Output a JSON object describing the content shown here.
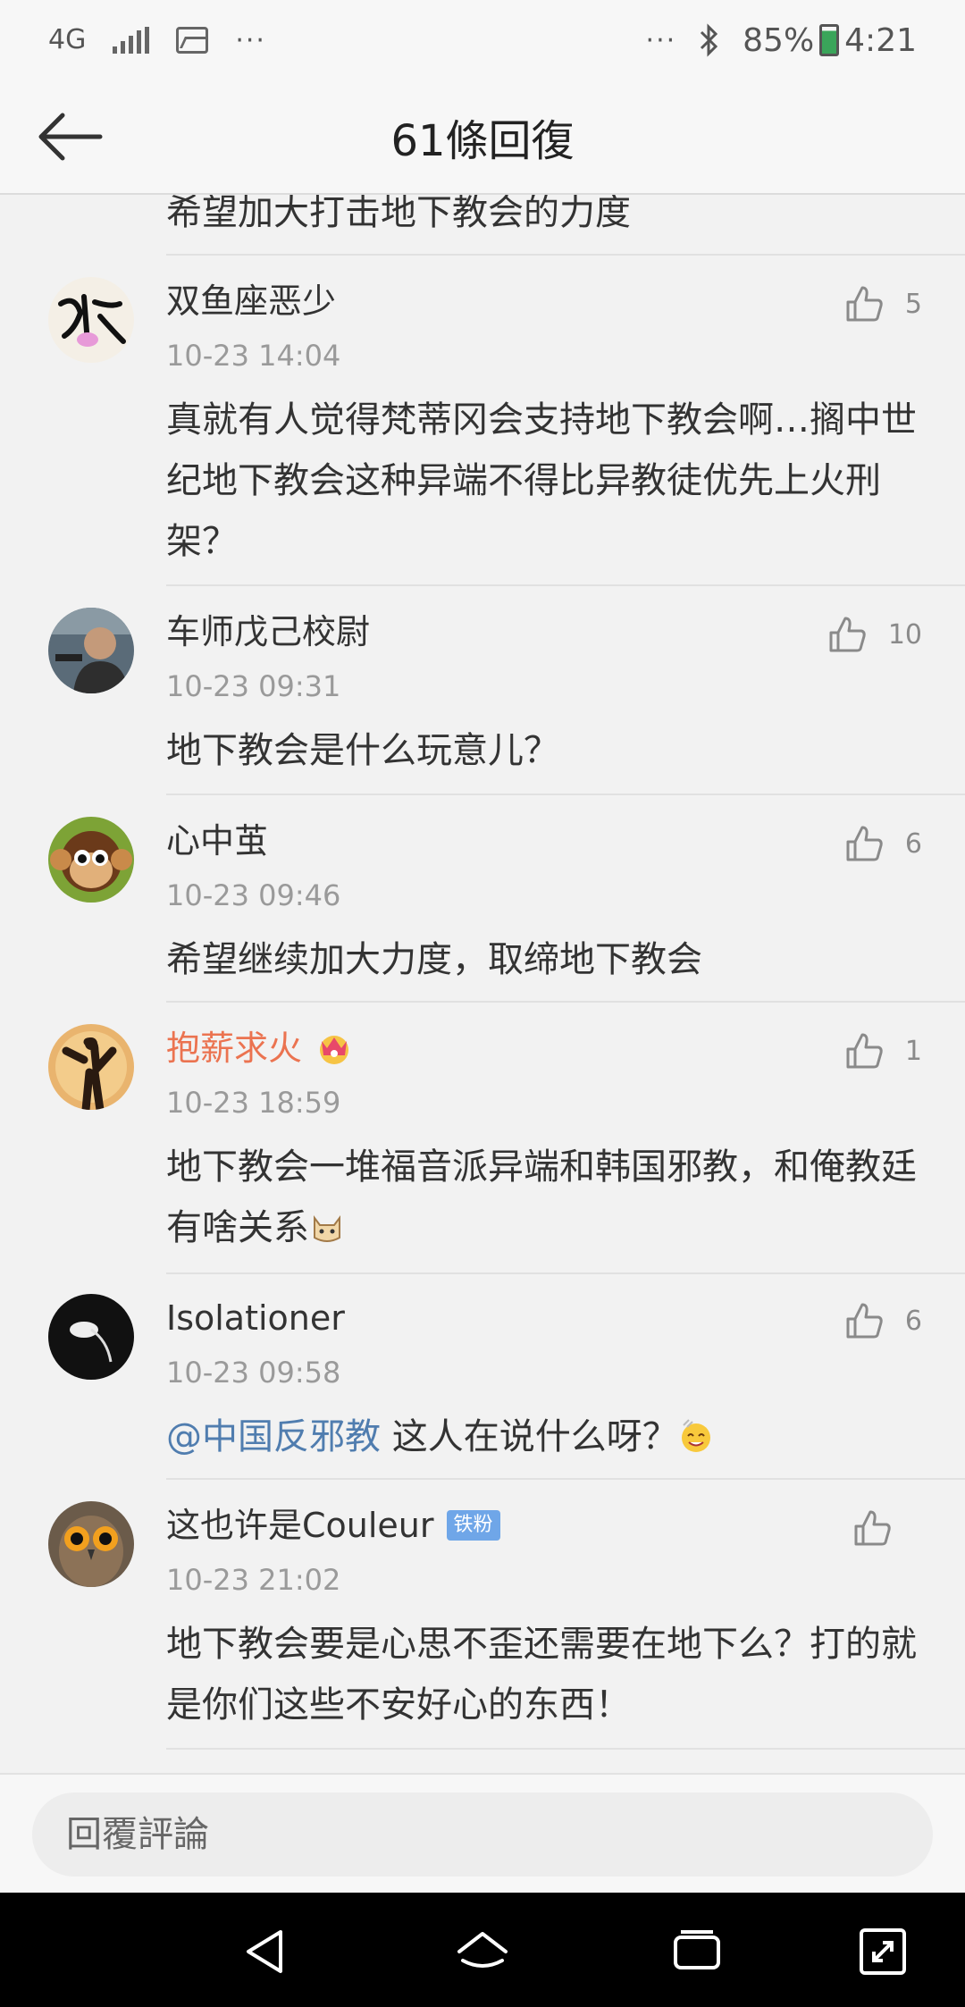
{
  "status": {
    "network": "4G",
    "battery": "85%",
    "time": "4:21",
    "more": "···",
    "more_right": "···"
  },
  "header": {
    "title": "61條回復"
  },
  "top_fragment": "希望加大打击地下教会的力度",
  "comments": [
    {
      "name": "双鱼座恶少",
      "time": "10-23 14:04",
      "likes": "5",
      "text": "真就有人觉得梵蒂冈会支持地下教会啊…搁中世纪地下教会这种异端不得比异教徒优先上火刑架？"
    },
    {
      "name": "车师戊己校尉",
      "time": "10-23 09:31",
      "likes": "10",
      "text": "地下教会是什么玩意儿？"
    },
    {
      "name": "心中茧",
      "time": "10-23 09:46",
      "likes": "6",
      "text": "希望继续加大力度，取缔地下教会"
    },
    {
      "name": "抱薪求火",
      "time": "10-23 18:59",
      "likes": "1",
      "text": "地下教会一堆福音派异端和韩国邪教，和俺教廷有啥关系"
    },
    {
      "name": "Isolationer",
      "time": "10-23 09:58",
      "likes": "6",
      "mention": "@中国反邪教",
      "text": "这人在说什么呀？"
    },
    {
      "name": "这也许是Couleur",
      "badge": "铁粉",
      "time": "10-23 21:02",
      "likes": "",
      "text": "地下教会要是心思不歪还需要在地下么？打的就是你们这些不安好心的东西！"
    }
  ],
  "compose": {
    "placeholder": "回覆評論"
  },
  "colors": {
    "accent_orange": "#eb7350",
    "mention_blue": "#507daf",
    "badge_blue": "#6fa6e8"
  }
}
